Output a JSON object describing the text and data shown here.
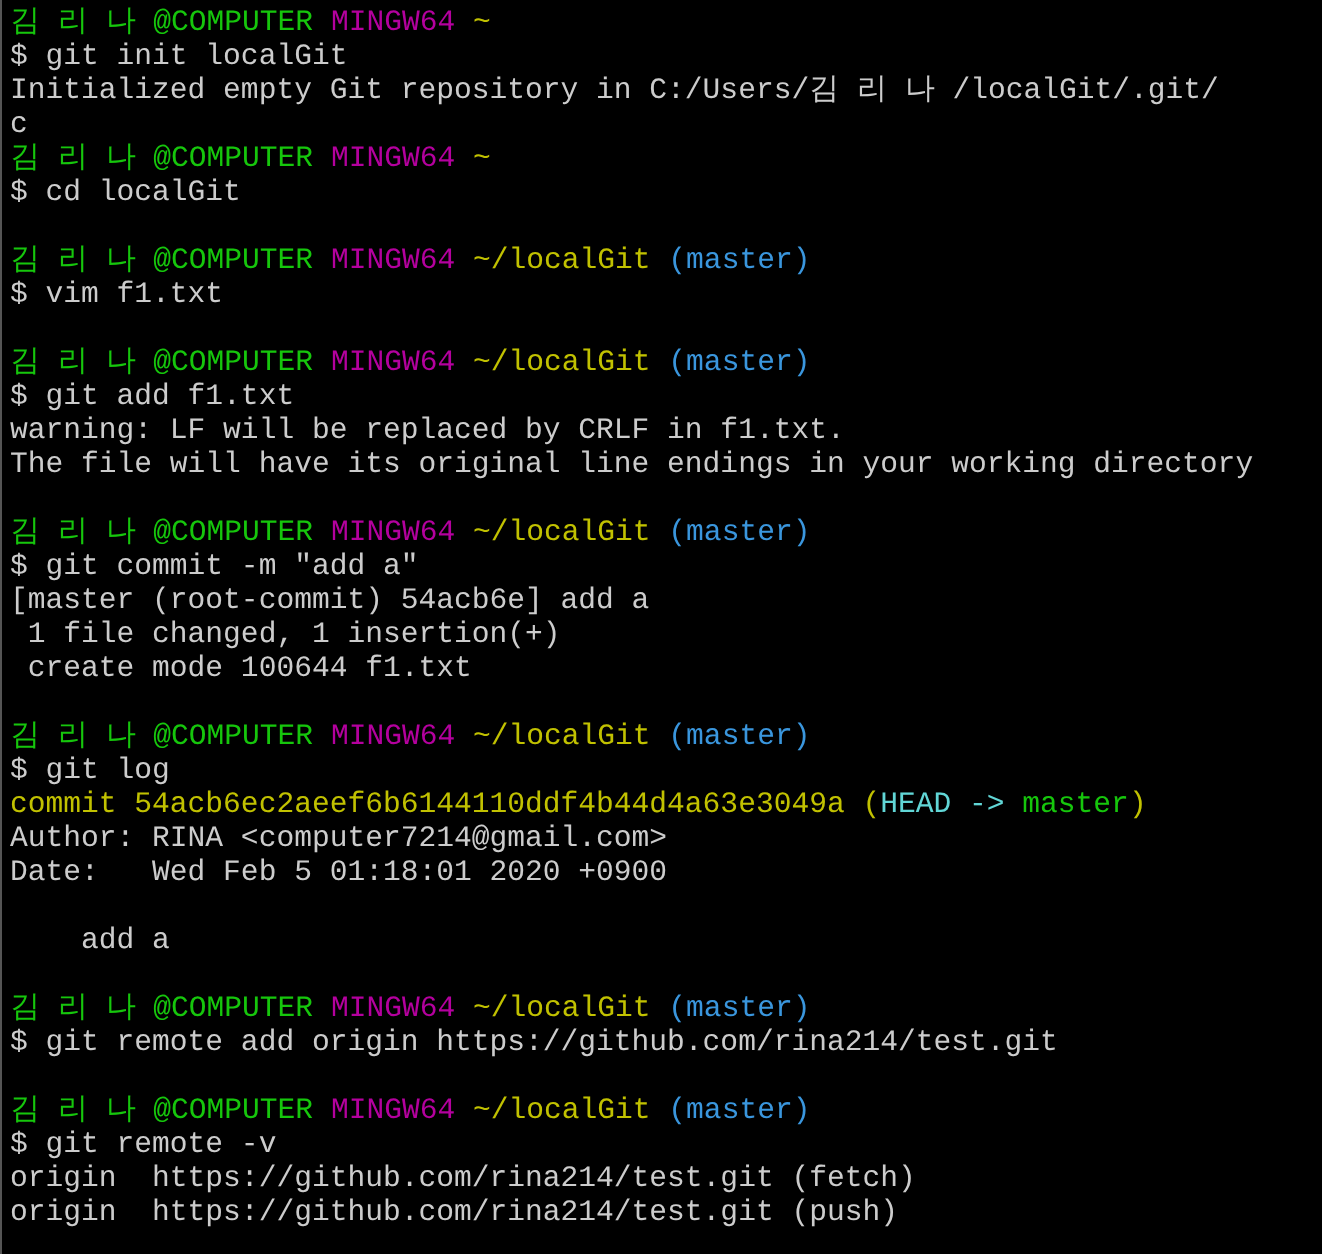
{
  "terminal": {
    "lines": [
      {
        "kind": "segments",
        "segments": [
          {
            "kind": "user",
            "text": "김 리 나 @COMPUTER"
          },
          {
            "kind": "host",
            "text": " MINGW64"
          },
          {
            "kind": "path",
            "text": " ~"
          }
        ]
      },
      {
        "kind": "command",
        "text": "$ git init localGit"
      },
      {
        "kind": "output",
        "text": "Initialized empty Git repository in C:/Users/김 리 나 /localGit/.git/"
      },
      {
        "kind": "output",
        "text": "c"
      },
      {
        "kind": "segments",
        "segments": [
          {
            "kind": "user",
            "text": "김 리 나 @COMPUTER"
          },
          {
            "kind": "host",
            "text": " MINGW64"
          },
          {
            "kind": "path",
            "text": " ~"
          }
        ]
      },
      {
        "kind": "command",
        "text": "$ cd localGit"
      },
      {
        "kind": "blank"
      },
      {
        "kind": "segments",
        "segments": [
          {
            "kind": "user",
            "text": "김 리 나 @COMPUTER"
          },
          {
            "kind": "host",
            "text": " MINGW64"
          },
          {
            "kind": "path",
            "text": " ~/localGit"
          },
          {
            "kind": "branch",
            "text": " (master)"
          }
        ]
      },
      {
        "kind": "command",
        "text": "$ vim f1.txt"
      },
      {
        "kind": "blank"
      },
      {
        "kind": "segments",
        "segments": [
          {
            "kind": "user",
            "text": "김 리 나 @COMPUTER"
          },
          {
            "kind": "host",
            "text": " MINGW64"
          },
          {
            "kind": "path",
            "text": " ~/localGit"
          },
          {
            "kind": "branch",
            "text": " (master)"
          }
        ]
      },
      {
        "kind": "command",
        "text": "$ git add f1.txt"
      },
      {
        "kind": "output",
        "text": "warning: LF will be replaced by CRLF in f1.txt."
      },
      {
        "kind": "output",
        "text": "The file will have its original line endings in your working directory"
      },
      {
        "kind": "blank"
      },
      {
        "kind": "segments",
        "segments": [
          {
            "kind": "user",
            "text": "김 리 나 @COMPUTER"
          },
          {
            "kind": "host",
            "text": " MINGW64"
          },
          {
            "kind": "path",
            "text": " ~/localGit"
          },
          {
            "kind": "branch",
            "text": " (master)"
          }
        ]
      },
      {
        "kind": "command",
        "text": "$ git commit -m \"add a\""
      },
      {
        "kind": "output",
        "text": "[master (root-commit) 54acb6e] add a"
      },
      {
        "kind": "output",
        "text": " 1 file changed, 1 insertion(+)"
      },
      {
        "kind": "output",
        "text": " create mode 100644 f1.txt"
      },
      {
        "kind": "blank"
      },
      {
        "kind": "segments",
        "segments": [
          {
            "kind": "user",
            "text": "김 리 나 @COMPUTER"
          },
          {
            "kind": "host",
            "text": " MINGW64"
          },
          {
            "kind": "path",
            "text": " ~/localGit"
          },
          {
            "kind": "branch",
            "text": " (master)"
          }
        ]
      },
      {
        "kind": "command",
        "text": "$ git log"
      },
      {
        "kind": "segments",
        "segments": [
          {
            "kind": "commit",
            "text": "commit 54acb6ec2aeef6b6144110ddf4b44d4a63e3049a"
          },
          {
            "kind": "commit",
            "text": " ("
          },
          {
            "kind": "head",
            "text": "HEAD ->"
          },
          {
            "kind": "ref",
            "text": " master"
          },
          {
            "kind": "commit",
            "text": ")"
          }
        ]
      },
      {
        "kind": "output",
        "text": "Author: RINA <computer7214@gmail.com>"
      },
      {
        "kind": "output",
        "text": "Date:   Wed Feb 5 01:18:01 2020 +0900"
      },
      {
        "kind": "blank"
      },
      {
        "kind": "output",
        "text": "    add a"
      },
      {
        "kind": "blank"
      },
      {
        "kind": "segments",
        "segments": [
          {
            "kind": "user",
            "text": "김 리 나 @COMPUTER"
          },
          {
            "kind": "host",
            "text": " MINGW64"
          },
          {
            "kind": "path",
            "text": " ~/localGit"
          },
          {
            "kind": "branch",
            "text": " (master)"
          }
        ]
      },
      {
        "kind": "command",
        "text": "$ git remote add origin https://github.com/rina214/test.git"
      },
      {
        "kind": "blank"
      },
      {
        "kind": "segments",
        "segments": [
          {
            "kind": "user",
            "text": "김 리 나 @COMPUTER"
          },
          {
            "kind": "host",
            "text": " MINGW64"
          },
          {
            "kind": "path",
            "text": " ~/localGit"
          },
          {
            "kind": "branch",
            "text": " (master)"
          }
        ]
      },
      {
        "kind": "command",
        "text": "$ git remote -v"
      },
      {
        "kind": "output",
        "text": "origin  https://github.com/rina214/test.git (fetch)"
      },
      {
        "kind": "output",
        "text": "origin  https://github.com/rina214/test.git (push)"
      }
    ]
  }
}
